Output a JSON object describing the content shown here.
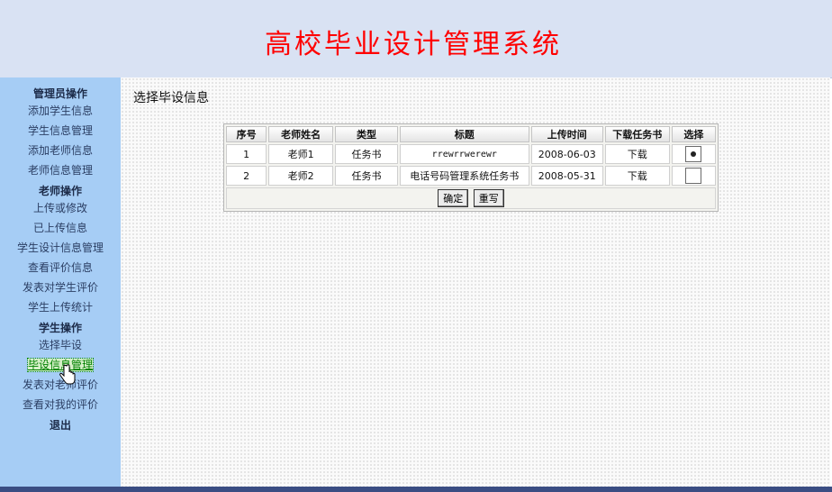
{
  "header": {
    "title": "高校毕业设计管理系统"
  },
  "sidebar": {
    "items": [
      {
        "label": "管理员操作",
        "group": true
      },
      {
        "label": "添加学生信息"
      },
      {
        "label": "学生信息管理"
      },
      {
        "label": "添加老师信息"
      },
      {
        "label": "老师信息管理"
      },
      {
        "label": "老师操作",
        "group": true
      },
      {
        "label": "上传或修改"
      },
      {
        "label": "已上传信息"
      },
      {
        "label": "学生设计信息管理"
      },
      {
        "label": "查看评价信息"
      },
      {
        "label": "发表对学生评价"
      },
      {
        "label": "学生上传统计"
      },
      {
        "label": "学生操作",
        "group": true
      },
      {
        "label": "选择毕设"
      },
      {
        "label": "毕设信息管理",
        "hover": true
      },
      {
        "label": "发表对老师评价"
      },
      {
        "label": "查看对我的评价"
      },
      {
        "label": "退出",
        "group": true
      }
    ]
  },
  "main": {
    "page_title": "选择毕设信息",
    "table": {
      "headers": [
        "序号",
        "老师姓名",
        "类型",
        "标题",
        "上传时间",
        "下载任务书",
        "选择"
      ],
      "rows": [
        {
          "no": "1",
          "teacher": "老师1",
          "type": "任务书",
          "title": "rrewrrwerewr",
          "date": "2008-06-03",
          "download": "下载",
          "selected": true
        },
        {
          "no": "2",
          "teacher": "老师2",
          "type": "任务书",
          "title": "电话号码管理系统任务书",
          "date": "2008-05-31",
          "download": "下载",
          "selected": false
        }
      ]
    },
    "buttons": {
      "confirm": "确定",
      "reset": "重写"
    }
  }
}
